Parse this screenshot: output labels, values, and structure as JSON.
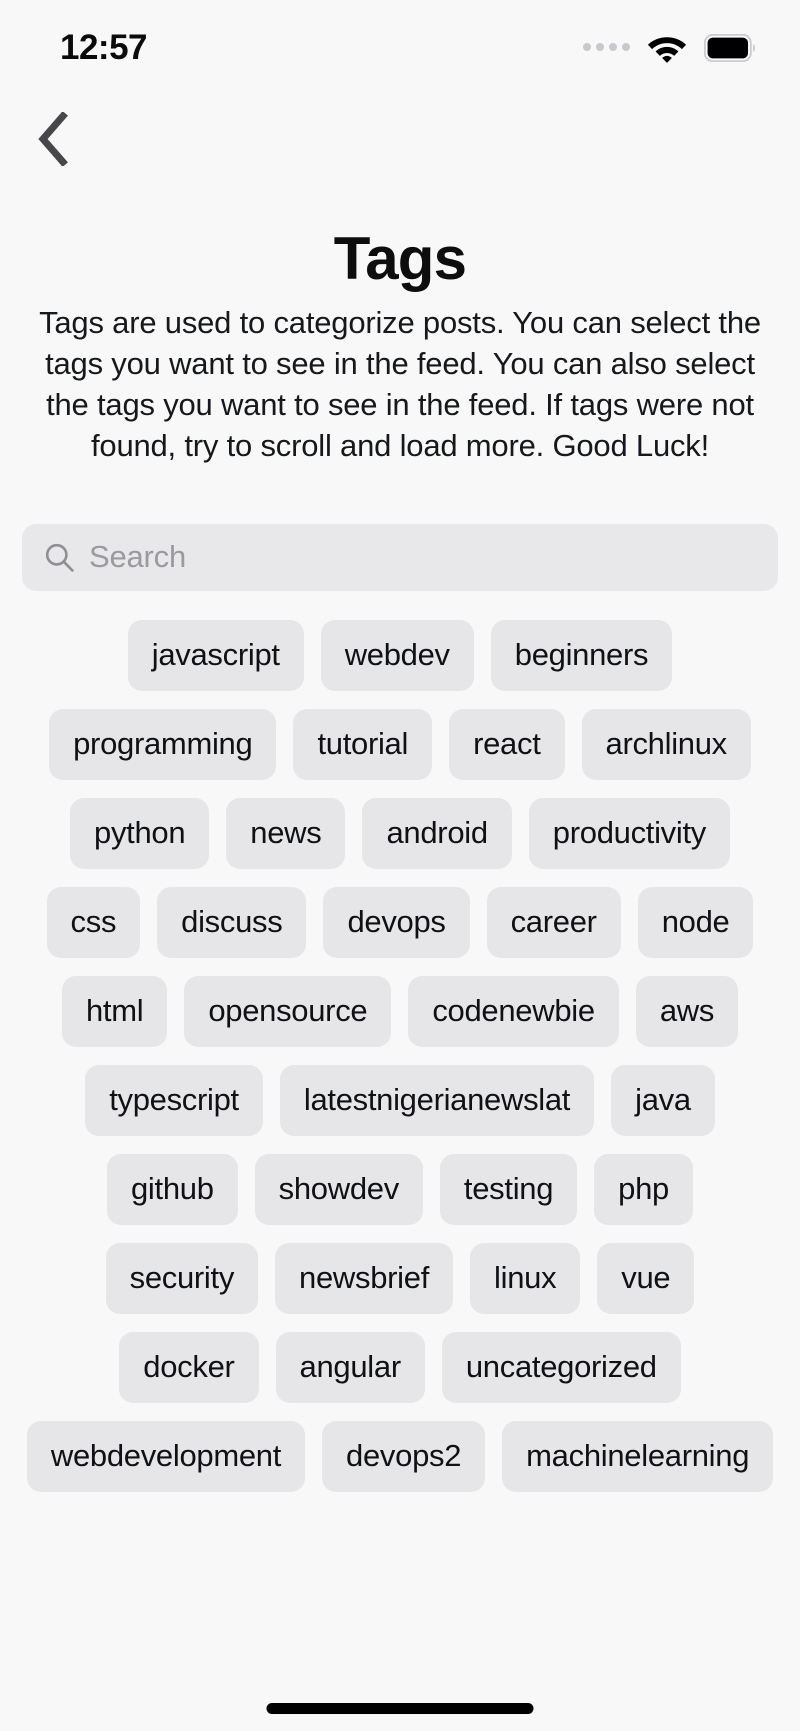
{
  "status_bar": {
    "time": "12:57",
    "signal_dots_count": 4,
    "wifi_icon": "wifi-icon",
    "battery_icon": "battery-full-icon"
  },
  "nav": {
    "back_icon": "chevron-left-icon"
  },
  "header": {
    "title": "Tags",
    "description": "Tags are used to categorize posts. You can select the tags you want to see in the feed. You can also select the tags you want to see in the feed. If tags were not found, try to scroll and load more. Good Luck!"
  },
  "search": {
    "icon": "search-icon",
    "placeholder": "Search",
    "value": ""
  },
  "tag_rows": [
    [
      "javascript",
      "webdev",
      "beginners"
    ],
    [
      "programming",
      "tutorial",
      "react",
      "archlinux"
    ],
    [
      "python",
      "news",
      "android",
      "productivity"
    ],
    [
      "css",
      "discuss",
      "devops",
      "career",
      "node"
    ],
    [
      "html",
      "opensource",
      "codenewbie",
      "aws"
    ],
    [
      "typescript",
      "latestnigerianewslat",
      "java"
    ],
    [
      "github",
      "showdev",
      "testing",
      "php"
    ],
    [
      "security",
      "newsbrief",
      "linux",
      "vue"
    ],
    [
      "docker",
      "angular",
      "uncategorized"
    ],
    [
      "webdevelopment",
      "devops2",
      "machinelearning"
    ]
  ],
  "colors": {
    "background": "#f8f8f8",
    "pill_fill": "#e6e6e8",
    "search_fill": "#e8e8ea",
    "text": "#101114",
    "placeholder": "#9a9a9f",
    "chevron": "#46464b",
    "home_indicator": "#000000"
  }
}
